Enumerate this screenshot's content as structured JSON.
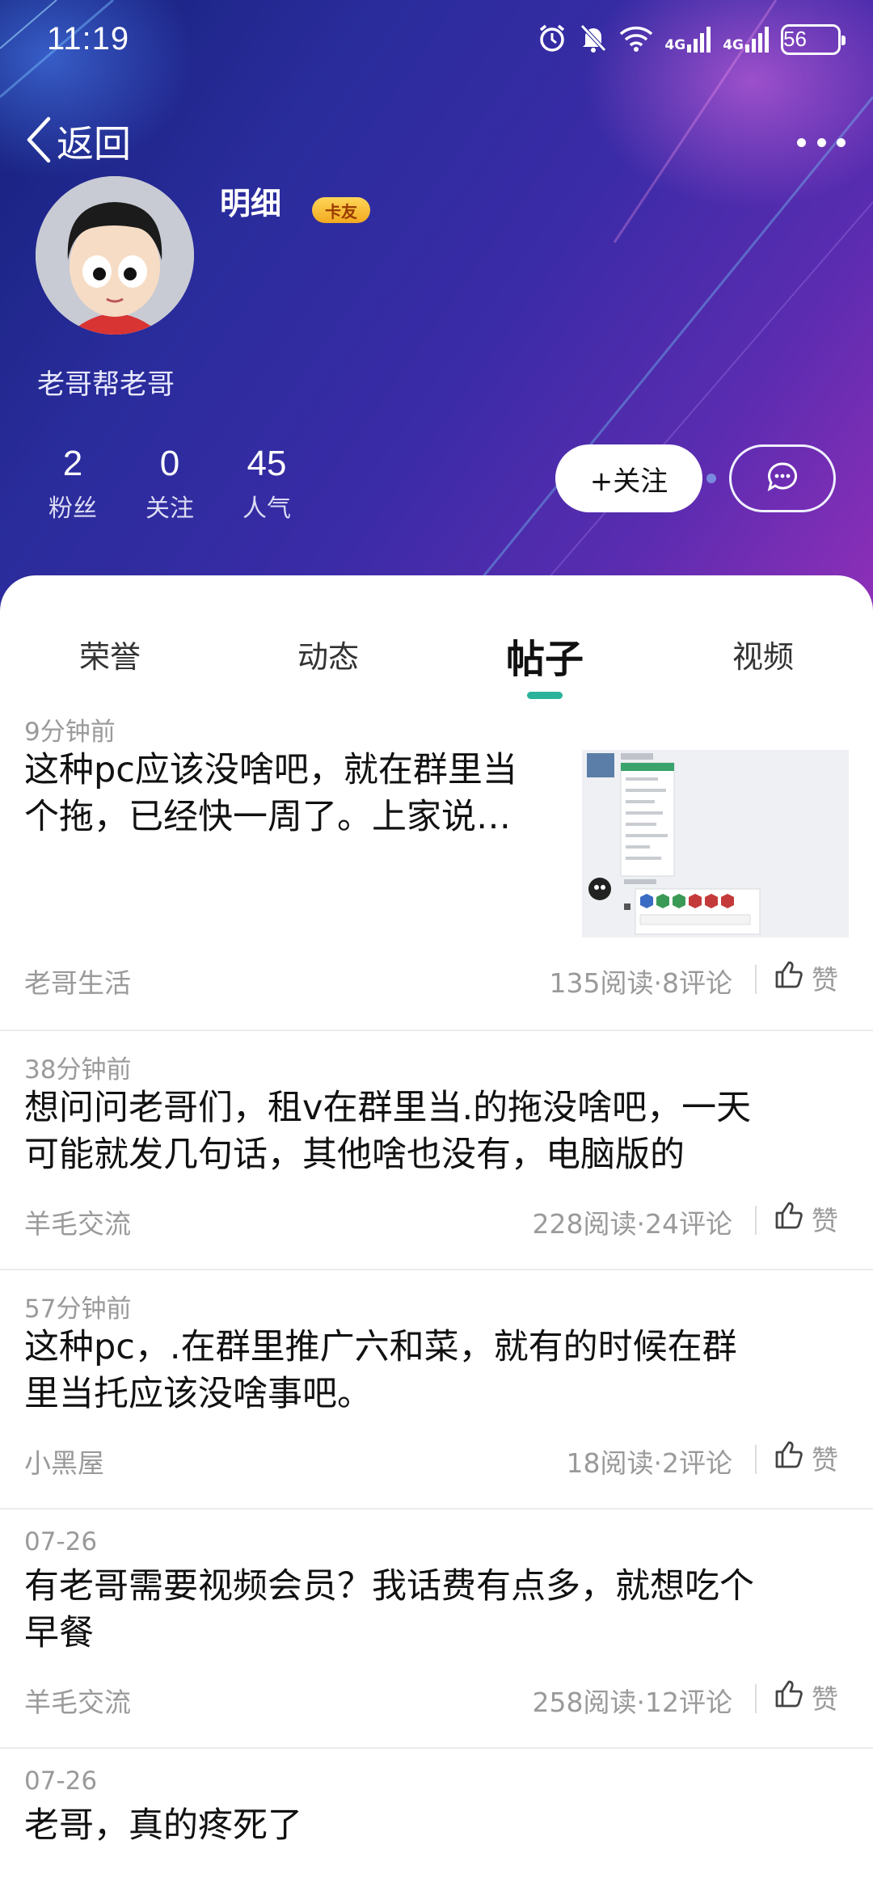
{
  "status_bar": {
    "time": "11:19",
    "network_1": "4G",
    "network_2": "4G",
    "battery": "56"
  },
  "nav": {
    "back_label": "返回"
  },
  "profile": {
    "username": "明细",
    "badge": "卡友",
    "bio": "老哥帮老哥",
    "stats": [
      {
        "value": "2",
        "label": "粉丝"
      },
      {
        "value": "0",
        "label": "关注"
      },
      {
        "value": "45",
        "label": "人气"
      }
    ],
    "follow_label": "+关注"
  },
  "tabs": [
    "荣誉",
    "动态",
    "帖子",
    "视频"
  ],
  "active_tab": "帖子",
  "posts": [
    {
      "time": "9分钟前",
      "title_lines": [
        "这种pc应该没啥吧，就在群里当",
        "个拖，已经快一周了。上家说…"
      ],
      "category": "老哥生活",
      "meta": "135阅读·8评论",
      "like": "赞",
      "has_thumb": true
    },
    {
      "time": "38分钟前",
      "title_lines": [
        "想问问老哥们，租v在群里当.的拖没啥吧，一天",
        "可能就发几句话，其他啥也没有，电脑版的"
      ],
      "category": "羊毛交流",
      "meta": "228阅读·24评论",
      "like": "赞"
    },
    {
      "time": "57分钟前",
      "title_lines": [
        "这种pc，.在群里推广六和菜，就有的时候在群",
        "里当托应该没啥事吧。"
      ],
      "category": "小黑屋",
      "meta": "18阅读·2评论",
      "like": "赞"
    },
    {
      "time": "07-26",
      "title_lines": [
        "有老哥需要视频会员？我话费有点多，就想吃个",
        "早餐"
      ],
      "category": "羊毛交流",
      "meta": "258阅读·12评论",
      "like": "赞"
    },
    {
      "time": "07-26",
      "title_lines": [
        "老哥，真的疼死了"
      ],
      "category": "",
      "meta": "",
      "like": ""
    }
  ],
  "colors": {
    "accent": "#2ab39a",
    "hero_start": "#14217a",
    "hero_end": "#8f2fb8",
    "badge": "#f2a91f"
  }
}
